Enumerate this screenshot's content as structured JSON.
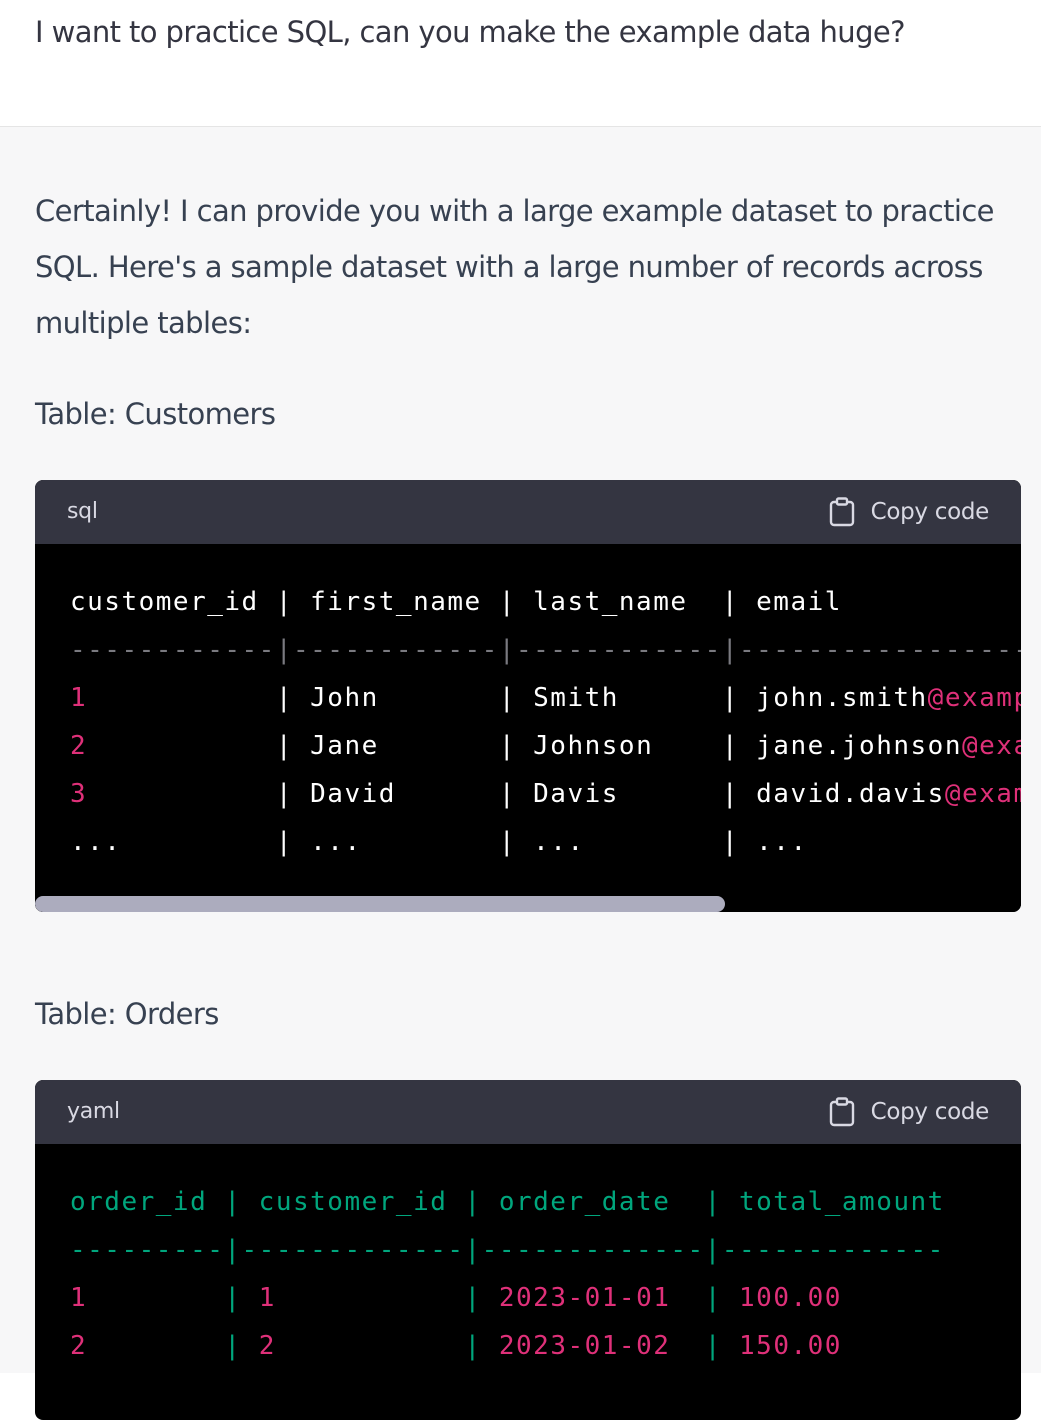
{
  "user_message": "I want to practice SQL, can you make the example data huge?",
  "assistant": {
    "intro": "Certainly! I can provide you with a large example dataset to practice SQL. Here's a sample dataset with a large number of records across multiple tables:",
    "customers_label": "Table: Customers",
    "orders_label": "Table: Orders"
  },
  "customers_block": {
    "lang": "sql",
    "copy_label": "Copy code",
    "scroll_fraction": 0.7,
    "lines": [
      {
        "segments": [
          {
            "text": "customer_id | first_name | last_name  | email",
            "color": "white"
          }
        ]
      },
      {
        "segments": [
          {
            "text": "------------|------------|------------|-------------------",
            "color": "grey"
          }
        ]
      },
      {
        "segments": [
          {
            "text": "1",
            "color": "pink"
          },
          {
            "text": "           | John       | Smith      | john.smith",
            "color": "white"
          },
          {
            "text": "@example.com",
            "color": "pink"
          }
        ]
      },
      {
        "segments": [
          {
            "text": "2",
            "color": "pink"
          },
          {
            "text": "           | Jane       | Johnson    | jane.johnson",
            "color": "white"
          },
          {
            "text": "@example.com",
            "color": "pink"
          }
        ]
      },
      {
        "segments": [
          {
            "text": "3",
            "color": "pink"
          },
          {
            "text": "           | David      | Davis      | david.davis",
            "color": "white"
          },
          {
            "text": "@example.com",
            "color": "pink"
          }
        ]
      },
      {
        "segments": [
          {
            "text": "...         | ...        | ...        | ...",
            "color": "white"
          }
        ]
      }
    ]
  },
  "orders_block": {
    "lang": "yaml",
    "copy_label": "Copy code",
    "lines": [
      {
        "segments": [
          {
            "text": "order_id | customer_id | order_date  | total_amount",
            "color": "green"
          }
        ]
      },
      {
        "segments": [
          {
            "text": "---------|-------------|-------------|-------------",
            "color": "green"
          }
        ]
      },
      {
        "segments": [
          {
            "text": "1",
            "color": "pink"
          },
          {
            "text": "        | ",
            "color": "green"
          },
          {
            "text": "1",
            "color": "pink"
          },
          {
            "text": "           | ",
            "color": "green"
          },
          {
            "text": "2023-01-01",
            "color": "pink"
          },
          {
            "text": "  | ",
            "color": "green"
          },
          {
            "text": "100.00",
            "color": "pink"
          }
        ]
      },
      {
        "segments": [
          {
            "text": "2",
            "color": "pink"
          },
          {
            "text": "        | ",
            "color": "green"
          },
          {
            "text": "2",
            "color": "pink"
          },
          {
            "text": "           | ",
            "color": "green"
          },
          {
            "text": "2023-01-02",
            "color": "pink"
          },
          {
            "text": "  | ",
            "color": "green"
          },
          {
            "text": "150.00",
            "color": "pink"
          }
        ]
      }
    ]
  },
  "colors": {
    "white": "#ffffff",
    "pink": "#df3079",
    "grey": "#7a7a80",
    "green": "#00a67d"
  },
  "icons": {
    "copy": "clipboard-icon"
  }
}
